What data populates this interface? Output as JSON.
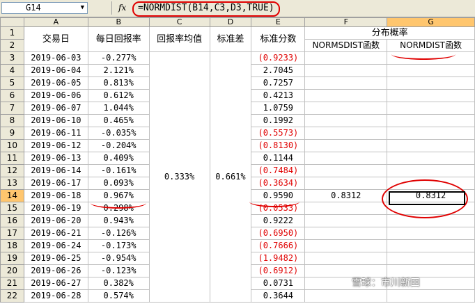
{
  "formula_bar": {
    "name_box": "G14",
    "fx_label": "fx",
    "formula": "=NORMDIST(B14,C3,D3,TRUE)"
  },
  "columns": [
    "A",
    "B",
    "C",
    "D",
    "E",
    "F",
    "G"
  ],
  "header": {
    "date": "交易日",
    "daily_return": "每日回报率",
    "mean_return": "回报率均值",
    "stdev": "标准差",
    "zscore": "标准分数",
    "distribution": "分布概率",
    "normsdist": "NORMSDIST函数",
    "normdist": "NORMDIST函数"
  },
  "merged_values": {
    "mean": "0.333%",
    "stdev": "0.661%"
  },
  "row14_results": {
    "f": "0.8312",
    "g": "0.8312"
  },
  "rows": [
    {
      "n": "3",
      "date": "2019-06-03",
      "ret": "-0.277%",
      "z": "(0.9233)",
      "neg": true
    },
    {
      "n": "4",
      "date": "2019-06-04",
      "ret": "2.121%",
      "z": "2.7045",
      "neg": false
    },
    {
      "n": "5",
      "date": "2019-06-05",
      "ret": "0.813%",
      "z": "0.7257",
      "neg": false
    },
    {
      "n": "6",
      "date": "2019-06-06",
      "ret": "0.612%",
      "z": "0.4213",
      "neg": false
    },
    {
      "n": "7",
      "date": "2019-06-07",
      "ret": "1.044%",
      "z": "1.0759",
      "neg": false
    },
    {
      "n": "8",
      "date": "2019-06-10",
      "ret": "0.465%",
      "z": "0.1992",
      "neg": false
    },
    {
      "n": "9",
      "date": "2019-06-11",
      "ret": "-0.035%",
      "z": "(0.5573)",
      "neg": true
    },
    {
      "n": "10",
      "date": "2019-06-12",
      "ret": "-0.204%",
      "z": "(0.8130)",
      "neg": true
    },
    {
      "n": "11",
      "date": "2019-06-13",
      "ret": "0.409%",
      "z": "0.1144",
      "neg": false
    },
    {
      "n": "12",
      "date": "2019-06-14",
      "ret": "-0.161%",
      "z": "(0.7484)",
      "neg": true
    },
    {
      "n": "13",
      "date": "2019-06-17",
      "ret": "0.093%",
      "z": "(0.3634)",
      "neg": true
    },
    {
      "n": "14",
      "date": "2019-06-18",
      "ret": "0.967%",
      "z": "0.9590",
      "neg": false
    },
    {
      "n": "15",
      "date": "2019-06-19",
      "ret": "0.298%",
      "z": "(0.0533)",
      "neg": true
    },
    {
      "n": "16",
      "date": "2019-06-20",
      "ret": "0.943%",
      "z": "0.9222",
      "neg": false
    },
    {
      "n": "17",
      "date": "2019-06-21",
      "ret": "-0.126%",
      "z": "(0.6950)",
      "neg": true
    },
    {
      "n": "18",
      "date": "2019-06-24",
      "ret": "-0.173%",
      "z": "(0.7666)",
      "neg": true
    },
    {
      "n": "19",
      "date": "2019-06-25",
      "ret": "-0.954%",
      "z": "(1.9482)",
      "neg": true
    },
    {
      "n": "20",
      "date": "2019-06-26",
      "ret": "-0.123%",
      "z": "(0.6912)",
      "neg": true
    },
    {
      "n": "21",
      "date": "2019-06-27",
      "ret": "0.382%",
      "z": "0.0731",
      "neg": false
    },
    {
      "n": "22",
      "date": "2019-06-28",
      "ret": "0.574%",
      "z": "0.3644",
      "neg": false
    }
  ],
  "watermark": "雪球：市川新田"
}
